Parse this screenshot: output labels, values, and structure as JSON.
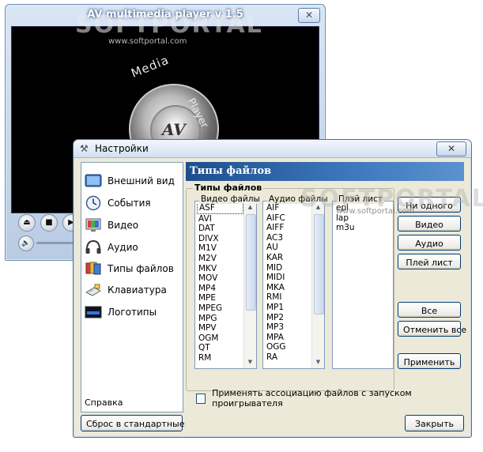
{
  "player": {
    "title": "AV multimedia player v 1.5",
    "close_glyph": "✕",
    "logo_media": "Media",
    "logo_player": "Player",
    "logo_av": "AV",
    "controls": [
      "eject-icon",
      "stop-icon",
      "play-icon"
    ],
    "volume_icon": "speaker-icon"
  },
  "watermark": {
    "text": "SOFTPORTAL",
    "url": "www.softportal.com"
  },
  "dialog": {
    "title": "Настройки",
    "close_glyph": "✕",
    "nav": [
      {
        "label": "Внешний вид",
        "icon": "appearance-icon"
      },
      {
        "label": "События",
        "icon": "clock-icon"
      },
      {
        "label": "Видео",
        "icon": "monitor-icon"
      },
      {
        "label": "Аудио",
        "icon": "headphones-icon"
      },
      {
        "label": "Типы файлов",
        "icon": "file-types-icon"
      },
      {
        "label": "Клавиатура",
        "icon": "keyboard-icon"
      },
      {
        "label": "Логотипы",
        "icon": "logo-icon"
      }
    ],
    "help_link": "Справка",
    "header": "Типы файлов",
    "group_label": "Типы файлов",
    "video_list": {
      "header": "Видео файлы",
      "items": [
        "ASF",
        "AVI",
        "DAT",
        "DIVX",
        "M1V",
        "M2V",
        "MKV",
        "MOV",
        "MP4",
        "MPE",
        "MPEG",
        "MPG",
        "MPV",
        "OGM",
        "QT",
        "RM"
      ],
      "selected": "ASF"
    },
    "audio_list": {
      "header": "Аудио файлы",
      "items": [
        "AIF",
        "AIFC",
        "AIFF",
        "AC3",
        "AU",
        "KAR",
        "MID",
        "MIDI",
        "MKA",
        "RMI",
        "MP1",
        "MP2",
        "MP3",
        "MPA",
        "OGG",
        "RA"
      ]
    },
    "playlist_list": {
      "header": "Плэй лист",
      "items": [
        "epl",
        "lap",
        "m3u"
      ]
    },
    "buttons": {
      "none": "Ни одного",
      "video": "Видео",
      "audio": "Аудио",
      "playlist": "Плей лист",
      "all": "Все",
      "cancel_all": "Отменить все",
      "apply": "Применить",
      "reset": "Сброс в стандартные",
      "close": "Закрыть"
    },
    "checkbox_label": "Применять ассоциацию файлов с запуском проигрывателя",
    "checkbox_checked": false
  }
}
